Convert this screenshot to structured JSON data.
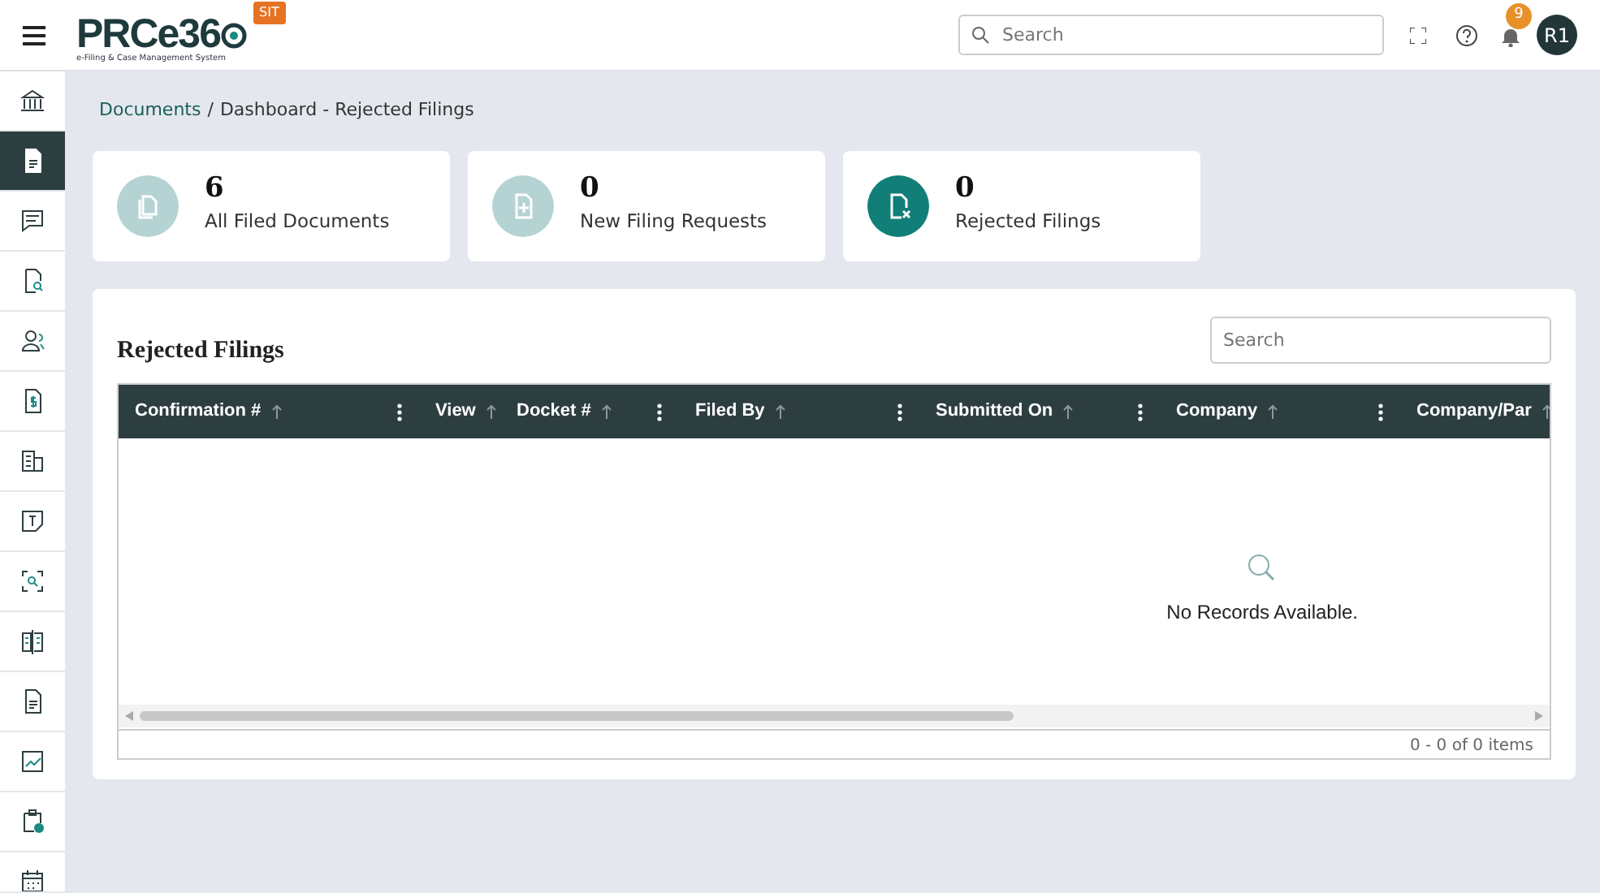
{
  "header": {
    "logo_text": "PRCe36",
    "tagline": "e-Filing & Case Management System",
    "env_badge": "SIT",
    "search": {
      "placeholder": "Search"
    },
    "notification_count": "9",
    "avatar": "R1"
  },
  "sidebar": {
    "items": [
      {
        "selected": false
      },
      {
        "selected": true
      },
      {
        "selected": false
      },
      {
        "selected": false
      },
      {
        "selected": false
      },
      {
        "selected": false
      },
      {
        "selected": false
      },
      {
        "selected": false
      },
      {
        "selected": false
      },
      {
        "selected": false
      },
      {
        "selected": false
      },
      {
        "selected": false
      },
      {
        "selected": false
      },
      {
        "selected": false
      }
    ]
  },
  "breadcrumb_separator": "/",
  "breadcrumb": [
    {
      "label": "Documents",
      "link": true
    },
    {
      "label": "Dashboard - Rejected Filings",
      "link": false
    }
  ],
  "stat_cards": [
    {
      "count": "6",
      "label": "All Filed Documents",
      "selected": false
    },
    {
      "count": "0",
      "label": "New Filing Requests",
      "selected": false
    },
    {
      "count": "0",
      "label": "Rejected Filings",
      "selected": true
    }
  ],
  "panel": {
    "title": "Rejected Filings",
    "search": {
      "placeholder": "Search"
    },
    "table": {
      "columns": [
        {
          "label": "Confirmation #",
          "has_menu": true
        },
        {
          "label": "View",
          "has_menu": false
        },
        {
          "label": "Docket #",
          "has_menu": true
        },
        {
          "label": "Filed By",
          "has_menu": true
        },
        {
          "label": "Submitted On",
          "has_menu": true
        },
        {
          "label": "Company",
          "has_menu": true
        },
        {
          "label": "Company/Par",
          "has_menu": false
        }
      ],
      "empty_message": "No Records Available."
    },
    "pager": "0 - 0 of 0 items"
  }
}
